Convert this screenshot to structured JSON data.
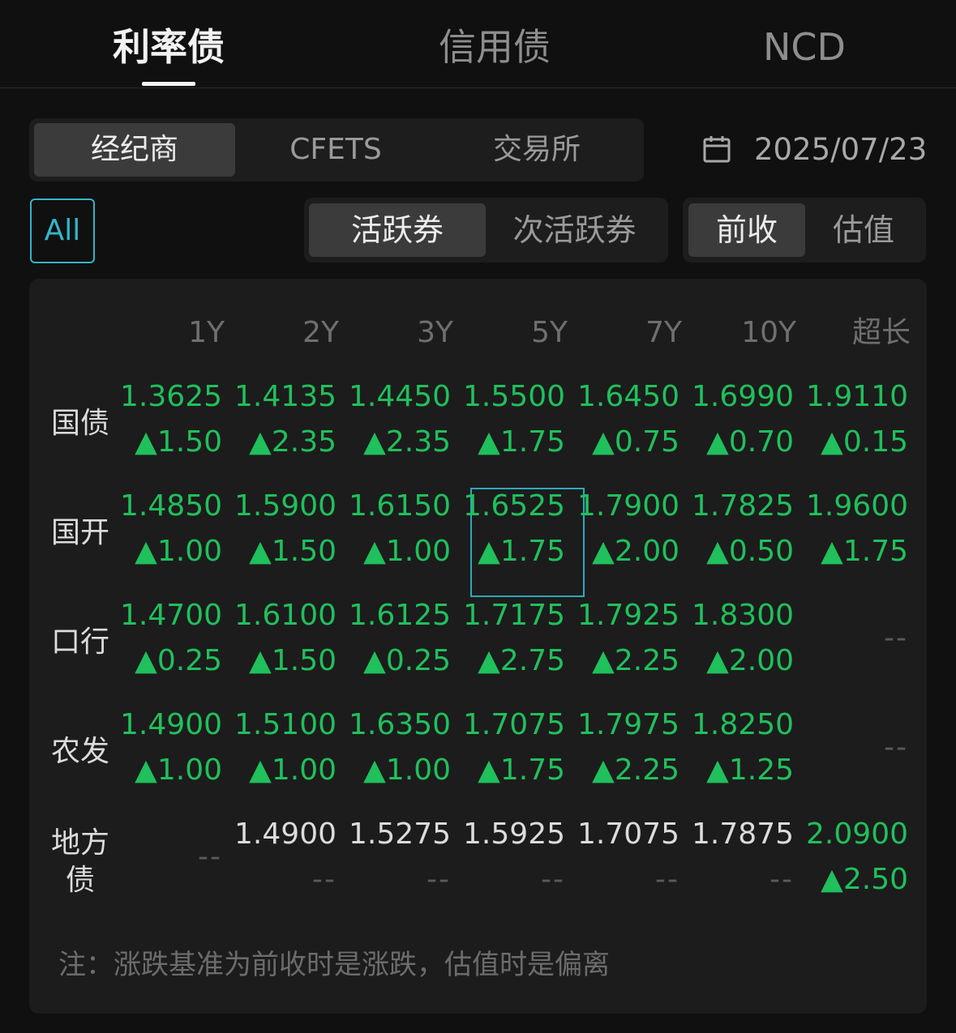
{
  "tabs": [
    {
      "label": "利率债",
      "active": true
    },
    {
      "label": "信用债",
      "active": false
    },
    {
      "label": "NCD",
      "active": false
    }
  ],
  "source_segments": [
    {
      "label": "经纪商",
      "active": true
    },
    {
      "label": "CFETS",
      "active": false
    },
    {
      "label": "交易所",
      "active": false
    }
  ],
  "date": "2025/07/23",
  "filter_all": "All",
  "bond_segments": [
    {
      "label": "活跃券",
      "active": true
    },
    {
      "label": "次活跃券",
      "active": false
    }
  ],
  "basis_segments": [
    {
      "label": "前收",
      "active": true
    },
    {
      "label": "估值",
      "active": false
    }
  ],
  "table": {
    "columns": [
      "1Y",
      "2Y",
      "3Y",
      "5Y",
      "7Y",
      "10Y",
      "超长"
    ],
    "rows": [
      {
        "label": "国债",
        "cells": [
          {
            "v": "1.3625",
            "c": "▲1.50"
          },
          {
            "v": "1.4135",
            "c": "▲2.35"
          },
          {
            "v": "1.4450",
            "c": "▲2.35"
          },
          {
            "v": "1.5500",
            "c": "▲1.75"
          },
          {
            "v": "1.6450",
            "c": "▲0.75"
          },
          {
            "v": "1.6990",
            "c": "▲0.70"
          },
          {
            "v": "1.9110",
            "c": "▲0.15"
          }
        ]
      },
      {
        "label": "国开",
        "cells": [
          {
            "v": "1.4850",
            "c": "▲1.00"
          },
          {
            "v": "1.5900",
            "c": "▲1.50"
          },
          {
            "v": "1.6150",
            "c": "▲1.00"
          },
          {
            "v": "1.6525",
            "c": "▲1.75",
            "highlight": true
          },
          {
            "v": "1.7900",
            "c": "▲2.00"
          },
          {
            "v": "1.7825",
            "c": "▲0.50"
          },
          {
            "v": "1.9600",
            "c": "▲1.75"
          }
        ]
      },
      {
        "label": "口行",
        "cells": [
          {
            "v": "1.4700",
            "c": "▲0.25"
          },
          {
            "v": "1.6100",
            "c": "▲1.50"
          },
          {
            "v": "1.6125",
            "c": "▲0.25"
          },
          {
            "v": "1.7175",
            "c": "▲2.75"
          },
          {
            "v": "1.7925",
            "c": "▲2.25"
          },
          {
            "v": "1.8300",
            "c": "▲2.00"
          },
          {
            "v": "--",
            "c": ""
          }
        ]
      },
      {
        "label": "农发",
        "cells": [
          {
            "v": "1.4900",
            "c": "▲1.00"
          },
          {
            "v": "1.5100",
            "c": "▲1.00"
          },
          {
            "v": "1.6350",
            "c": "▲1.00"
          },
          {
            "v": "1.7075",
            "c": "▲1.75"
          },
          {
            "v": "1.7975",
            "c": "▲2.25"
          },
          {
            "v": "1.8250",
            "c": "▲1.25"
          },
          {
            "v": "--",
            "c": ""
          }
        ]
      },
      {
        "label": "地方\n债",
        "cells": [
          {
            "v": "--",
            "c": ""
          },
          {
            "v": "1.4900",
            "c": "--"
          },
          {
            "v": "1.5275",
            "c": "--"
          },
          {
            "v": "1.5925",
            "c": "--"
          },
          {
            "v": "1.7075",
            "c": "--"
          },
          {
            "v": "1.7875",
            "c": "--"
          },
          {
            "v": "2.0900",
            "c": "▲2.50"
          }
        ]
      }
    ]
  },
  "note": "注：涨跌基准为前收时是涨跌，估值时是偏离",
  "colors": {
    "up": "#20c05c",
    "accent": "#33b5c8",
    "neutral": "#dcdcdc",
    "dash": "#5a5a5a"
  }
}
